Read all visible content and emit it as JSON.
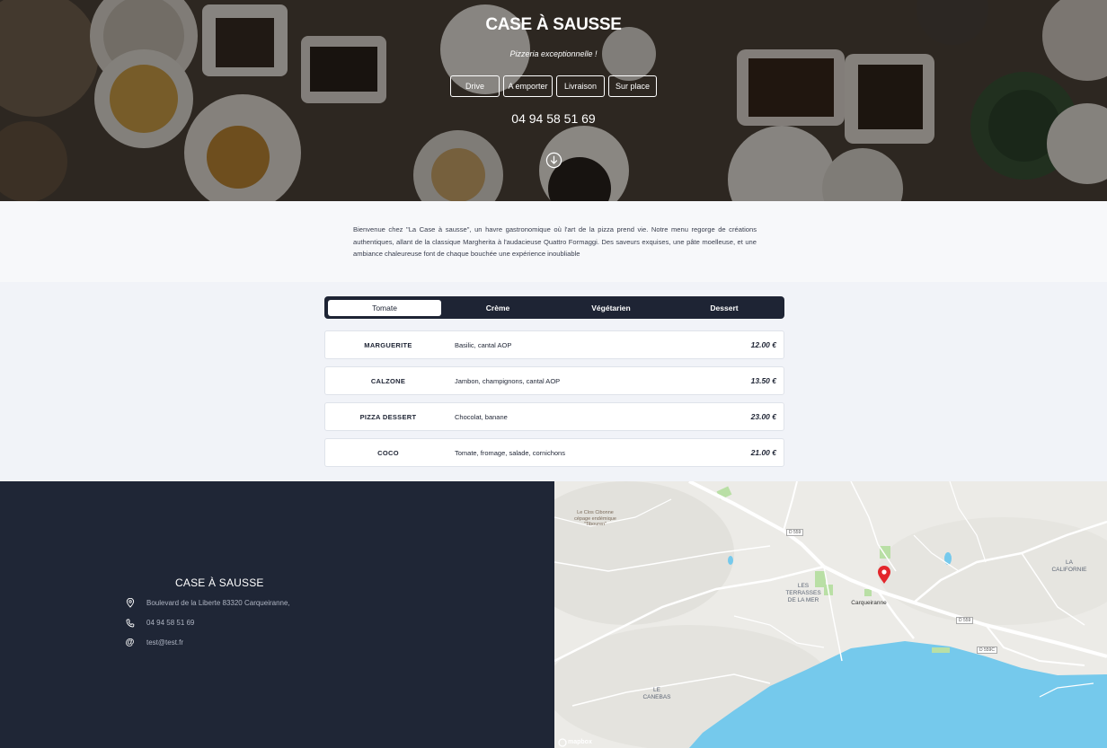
{
  "hero": {
    "title": "CASE À SAUSSE",
    "subtitle": "Pizzeria exceptionnelle !",
    "buttons": [
      "Drive",
      "A emporter",
      "Livraison",
      "Sur place"
    ],
    "phone": "04 94 58 51 69",
    "scroll_icon": "arrow-down-circle-icon"
  },
  "intro": {
    "text": "Bienvenue chez \"La Case à sausse\", un havre gastronomique où l'art de la pizza prend vie. Notre menu regorge de créations authentiques, allant de la classique Margherita à l'audacieuse Quattro Formaggi. Des saveurs exquises, une pâte moelleuse, et une ambiance chaleureuse font de chaque bouchée une expérience inoubliable"
  },
  "menu": {
    "tabs": [
      "Tomate",
      "Crème",
      "Végétarien",
      "Dessert"
    ],
    "active_tab": 0,
    "items": [
      {
        "name": "MARGUERITE",
        "desc": "Basilic, cantal AOP",
        "price": "12.00 €"
      },
      {
        "name": "CALZONE",
        "desc": "Jambon, champignons, cantal AOP",
        "price": "13.50 €"
      },
      {
        "name": "PIZZA DESSERT",
        "desc": "Chocolat, banane",
        "price": "23.00 €"
      },
      {
        "name": "COCO",
        "desc": "Tomate, fromage, salade, cornichons",
        "price": "21.00 €"
      }
    ]
  },
  "footer": {
    "title": "CASE À SAUSSE",
    "address": "Boulevard de la Liberte 83320 Carqueiranne,",
    "phone": "04 94 58 51 69",
    "email": "test@test.fr",
    "icons": [
      "map-pin-icon",
      "phone-icon",
      "at-icon"
    ]
  },
  "map": {
    "labels": {
      "clos": "Le Clos Cibonne\ncépage endémique\n\"Tibouren\"",
      "terrasses": "LES\nTERRASSES\nDE LA MER",
      "town": "Carqueiranne",
      "californie": "LA\nCALIFORNIE",
      "canebas": "LE\nCANEBAS",
      "d559": "D 559",
      "d559b": "D 559",
      "d559c": "D 559C",
      "logo": "mapbox"
    },
    "colors": {
      "sea": "#75c9ec",
      "land": "#ecebe7",
      "park": "#b9dfa5",
      "pin": "#e3262b"
    }
  },
  "colors": {
    "dark": "#1e2434",
    "footer": "#1f2636"
  }
}
